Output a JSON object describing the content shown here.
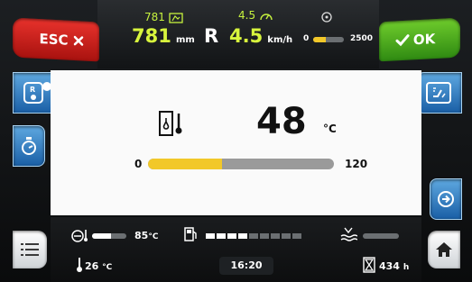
{
  "topbar": {
    "distance_set": "781",
    "distance_value": "781",
    "distance_unit": "mm",
    "gear": "R",
    "speed_set": "4.5",
    "speed_value": "4.5",
    "speed_unit": "km/h",
    "rpm_min": "0",
    "rpm_max": "2500",
    "rpm_level": 0.42
  },
  "buttons": {
    "esc_label": "ESC",
    "ok_label": "OK"
  },
  "panel": {
    "value": "48",
    "unit": "°C",
    "scale_min": "0",
    "scale_max": "120",
    "fill_fraction": 0.4,
    "page_dots": 6,
    "active_dot": 5
  },
  "status": {
    "temp_value": "85",
    "temp_unit": "°C",
    "ambient_value": "26",
    "ambient_unit": "°C",
    "clock": "16:20",
    "hours_value": "434",
    "hours_unit": "h"
  },
  "colors": {
    "accent_yellow": "#f2c829",
    "green_value": "#d8f53d",
    "esc_red": "#d62520",
    "ok_green": "#52b423",
    "blue_button": "#2f7cc2"
  },
  "icons": [
    "distance-flag-icon",
    "speedometer-icon",
    "rpm-icon",
    "close-x-icon",
    "check-icon",
    "fan-engine-icon",
    "timer-icon",
    "coolant-temp-icon",
    "arrow-right-icon",
    "menu-list-icon",
    "home-icon",
    "engine-temp-icon",
    "fuel-pump-icon",
    "water-level-icon",
    "thermometer-icon",
    "hourglass-icon",
    "climate-seat-icon"
  ]
}
